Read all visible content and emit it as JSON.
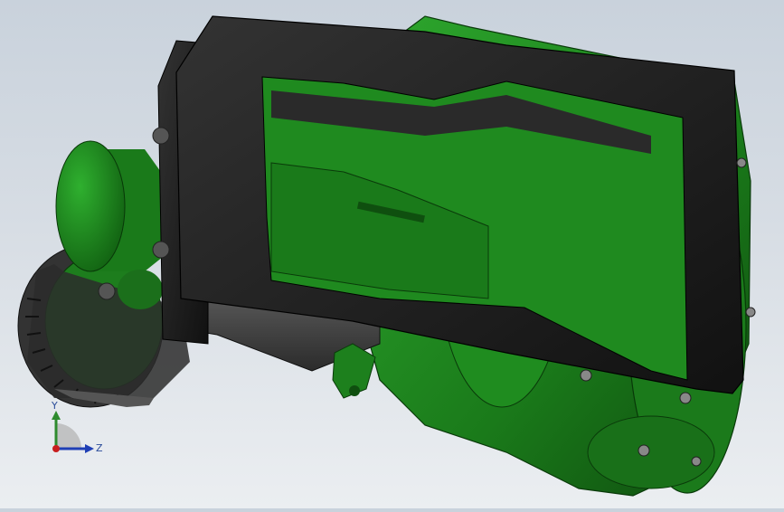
{
  "viewport": {
    "background_top": "#c9d2dc",
    "background_bottom": "#ebeef1",
    "model_colors": {
      "green": "#1f8a1f",
      "green_dark": "#0f4f0f",
      "black_frame": "#1a1a1a",
      "gray_part": "#4b4b4b"
    }
  },
  "triad": {
    "y_label": "Y",
    "z_label": "Z",
    "y_color": "#2e8b2e",
    "z_color": "#1f3fb5",
    "origin_color": "#c81e1e"
  }
}
